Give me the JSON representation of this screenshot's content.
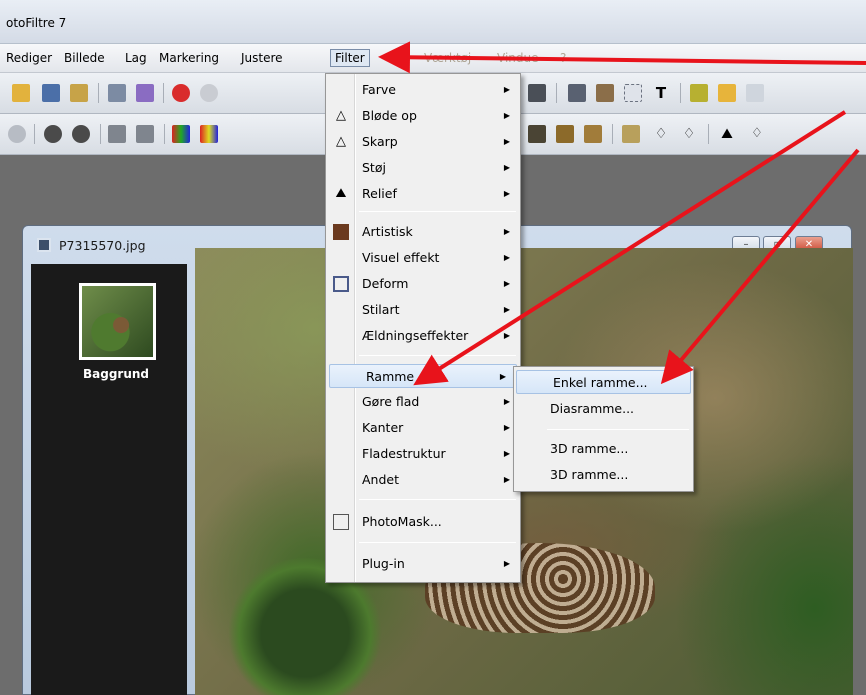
{
  "window": {
    "title": "otoFiltre 7"
  },
  "menubar": {
    "items": [
      "Rediger",
      "Billede",
      "Lag",
      "Markering",
      "Justere",
      "Filter",
      "Vis",
      "Værktøj",
      "Vindue",
      "?"
    ]
  },
  "document": {
    "filename": "P7315570.jpg",
    "layer_label": "Baggrund",
    "buttons": {
      "minimize": "–",
      "maximize": "▫",
      "close": "✕"
    }
  },
  "filter_menu": {
    "items": [
      {
        "label": "Farve",
        "icon": "",
        "submenu": true
      },
      {
        "label": "Bløde op",
        "icon": "drop-icon",
        "submenu": true
      },
      {
        "label": "Skarp",
        "icon": "triangle-icon",
        "submenu": true
      },
      {
        "label": "Støj",
        "icon": "",
        "submenu": true
      },
      {
        "label": "Relief",
        "icon": "mountain-icon",
        "submenu": true
      },
      {
        "label": "Artistisk",
        "icon": "portrait-icon",
        "submenu": true
      },
      {
        "label": "Visuel effekt",
        "icon": "",
        "submenu": true
      },
      {
        "label": "Deform",
        "icon": "grid-icon",
        "submenu": true
      },
      {
        "label": "Stilart",
        "icon": "",
        "submenu": true
      },
      {
        "label": "Ældningseffekter",
        "icon": "",
        "submenu": true
      },
      {
        "label": "Ramme",
        "icon": "",
        "submenu": true,
        "highlighted": true
      },
      {
        "label": "Gøre flad",
        "icon": "",
        "submenu": true
      },
      {
        "label": "Kanter",
        "icon": "",
        "submenu": true
      },
      {
        "label": "Fladestruktur",
        "icon": "",
        "submenu": true
      },
      {
        "label": "Andet",
        "icon": "",
        "submenu": true
      },
      {
        "label": "PhotoMask...",
        "icon": "mask-icon",
        "submenu": false
      },
      {
        "label": "Plug-in",
        "icon": "",
        "submenu": true
      }
    ]
  },
  "ramme_submenu": {
    "items": [
      "Enkel ramme...",
      "Diasramme...",
      "3D ramme...",
      "3D ramme..."
    ],
    "highlighted": "Enkel ramme..."
  },
  "colors": {
    "annotation_arrow": "#e8131b",
    "menu_highlight": "#d6e6f8"
  }
}
